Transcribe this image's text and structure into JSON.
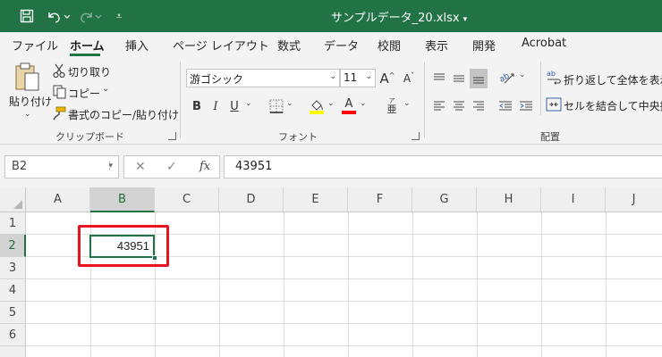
{
  "titlebar": {
    "filename": "サンプルデータ_20.xlsx",
    "caret": "▾",
    "customize_glyph": "⩡"
  },
  "tabs": [
    "ファイル",
    "ホーム",
    "挿入",
    "ページ レイアウト",
    "数式",
    "データ",
    "校閲",
    "表示",
    "開発",
    "Acrobat"
  ],
  "active_tab": "ホーム",
  "clipboard": {
    "paste_label": "貼り付け",
    "cut_label": "切り取り",
    "copy_label": "コピー",
    "format_painter_label": "書式のコピー/貼り付け",
    "group_label": "クリップボード"
  },
  "font": {
    "font_name": "游ゴシック",
    "font_size": "11",
    "grow_label": "A",
    "shrink_label": "A",
    "bold": "B",
    "italic": "I",
    "underline": "U",
    "font_color_letter": "A",
    "phonetic_top": "ア",
    "phonetic_bottom": "亜",
    "group_label": "フォント"
  },
  "alignment": {
    "wrap_text_label": "折り返して全体を表示す",
    "merge_center_label": "セルを結合して中央揃",
    "group_label": "配置"
  },
  "formula_bar": {
    "name_box": "B2",
    "dots": "⋮",
    "cancel": "✕",
    "enter": "✓",
    "fx": "fx",
    "content": "43951"
  },
  "grid": {
    "columns": [
      "A",
      "B",
      "C",
      "D",
      "E",
      "F",
      "G",
      "H",
      "I",
      "J"
    ],
    "rows": [
      "1",
      "2",
      "3",
      "4",
      "5",
      "6"
    ],
    "selected_column": "B",
    "selected_row": "2",
    "cell_b2_value": "43951"
  },
  "colors": {
    "excel_green": "#217346",
    "highlight_red": "#e5141e",
    "highlight_yellow": "#ffff00",
    "font_color_red": "#ff0000"
  },
  "icons": [
    "save-icon",
    "undo-icon",
    "redo-icon",
    "customize-qat-icon",
    "paste-icon",
    "cut-icon",
    "copy-icon",
    "format-painter-icon",
    "borders-icon",
    "fill-color-icon",
    "font-color-icon",
    "phonetic-icon",
    "orientation-icon",
    "wrap-text-icon",
    "merge-center-icon",
    "dialog-launcher-icon"
  ]
}
